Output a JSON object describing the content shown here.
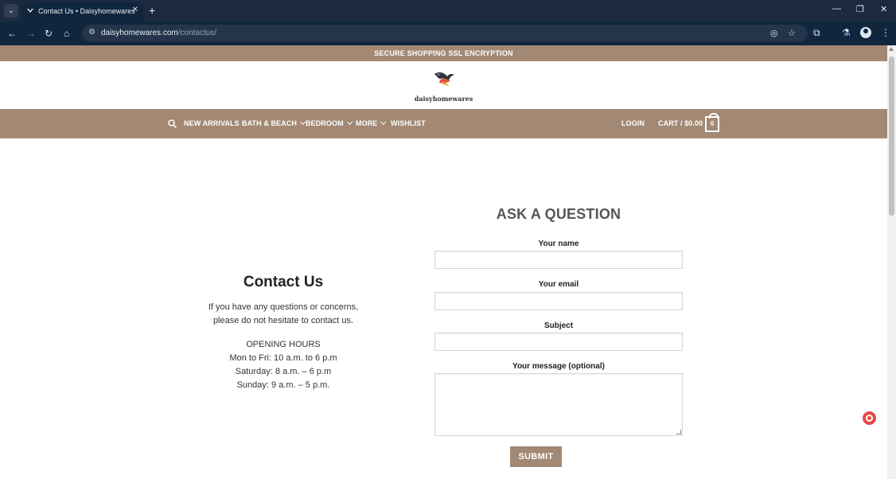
{
  "browser": {
    "tab_title": "Contact Us • Daisyhomewares",
    "tab_close": "✕",
    "new_tab": "+",
    "url_host": "daisyhomewares.com",
    "url_path": "/contactus/"
  },
  "site": {
    "top_banner": "SECURE SHOPPING SSL ENCRYPTION",
    "logo_text": "daisyhomewares",
    "brand_color": "#a38974"
  },
  "nav": {
    "items": [
      "NEW ARRIVALS",
      "BATH & BEACH",
      "BEDROOM",
      "MORE",
      "WISHLIST"
    ],
    "login": "LOGIN",
    "cart": "CART / $0.00",
    "cart_count": "0"
  },
  "contact": {
    "title": "Contact Us",
    "intro_line1": "If you have any questions or concerns,",
    "intro_line2": "please do not hesitate to contact us.",
    "hours_heading": "OPENING HOURS",
    "hours": [
      "Mon to Fri: 10 a.m. to 6 p.m",
      "Saturday: 8 a.m. – 6 p.m",
      "Sunday: 9 a.m. – 5 p.m."
    ]
  },
  "form": {
    "title": "ASK A QUESTION",
    "name_label": "Your name",
    "email_label": "Your email",
    "subject_label": "Subject",
    "message_label": "Your message (optional)",
    "submit_label": "SUBMIT"
  }
}
